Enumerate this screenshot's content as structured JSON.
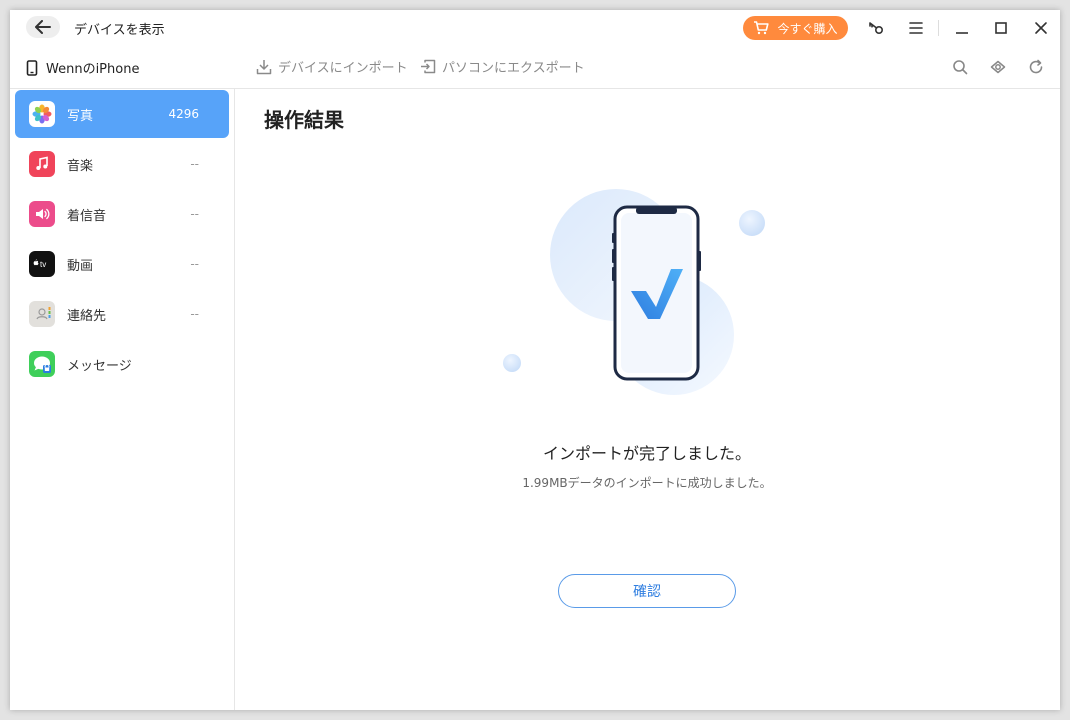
{
  "titlebar": {
    "title": "デバイスを表示",
    "buy_label": "今すぐ購入"
  },
  "toolbar": {
    "device_name": "WennのiPhone",
    "import_label": "デバイスにインポート",
    "export_label": "パソコンにエクスポート"
  },
  "sidebar": {
    "items": [
      {
        "label": "写真",
        "count": "4296",
        "icon": "photos-icon",
        "active": true
      },
      {
        "label": "音楽",
        "count": "--",
        "icon": "music-icon"
      },
      {
        "label": "着信音",
        "count": "--",
        "icon": "ringtone-icon"
      },
      {
        "label": "動画",
        "count": "--",
        "icon": "tv-icon"
      },
      {
        "label": "連絡先",
        "count": "--",
        "icon": "contacts-icon"
      },
      {
        "label": "メッセージ",
        "count": "",
        "icon": "messages-icon"
      }
    ]
  },
  "main": {
    "title": "操作結果",
    "result_title": "インポートが完了しました。",
    "result_sub": "1.99MBデータのインポートに成功しました。",
    "confirm_label": "確認"
  },
  "colors": {
    "accent": "#57a3f9",
    "buy": "#ff8a3d",
    "confirm_border": "#5a9be8"
  }
}
